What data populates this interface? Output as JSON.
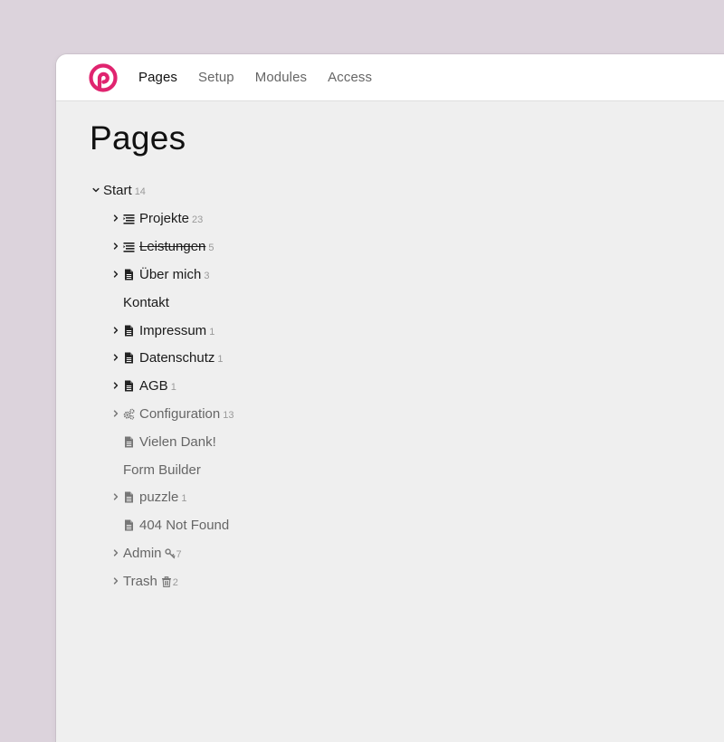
{
  "nav": {
    "items": [
      {
        "label": "Pages",
        "active": true
      },
      {
        "label": "Setup",
        "active": false
      },
      {
        "label": "Modules",
        "active": false
      },
      {
        "label": "Access",
        "active": false
      }
    ]
  },
  "page_title": "Pages",
  "colors": {
    "brand": "#e0246f",
    "background": "#dcd3dc",
    "content": "#efefef"
  },
  "tree": {
    "start": {
      "label": "Start",
      "count": "14",
      "icon": "chevron-down-icon"
    },
    "items": [
      {
        "label": "Projekte",
        "count": "23",
        "icon": "list-icon"
      },
      {
        "label": "Leistungen",
        "count": "5",
        "icon": "list-icon"
      },
      {
        "label": "Über mich",
        "count": "3",
        "icon": "document-icon"
      },
      {
        "label": "Kontakt"
      },
      {
        "label": "Impressum",
        "count": "1",
        "icon": "document-icon"
      },
      {
        "label": "Datenschutz",
        "count": "1",
        "icon": "document-icon"
      },
      {
        "label": "AGB",
        "count": "1",
        "icon": "document-icon"
      },
      {
        "label": "Configuration",
        "count": "13",
        "icon": "gears-icon"
      },
      {
        "label": "Vielen Dank!",
        "icon": "document-icon"
      },
      {
        "label": "Form Builder"
      },
      {
        "label": "puzzle",
        "count": "1",
        "icon": "document-icon"
      },
      {
        "label": "404 Not Found",
        "icon": "document-icon"
      },
      {
        "label": "Admin",
        "count": "7",
        "icon": "key-icon"
      },
      {
        "label": "Trash",
        "count": "2",
        "icon": "trash-icon"
      }
    ]
  }
}
